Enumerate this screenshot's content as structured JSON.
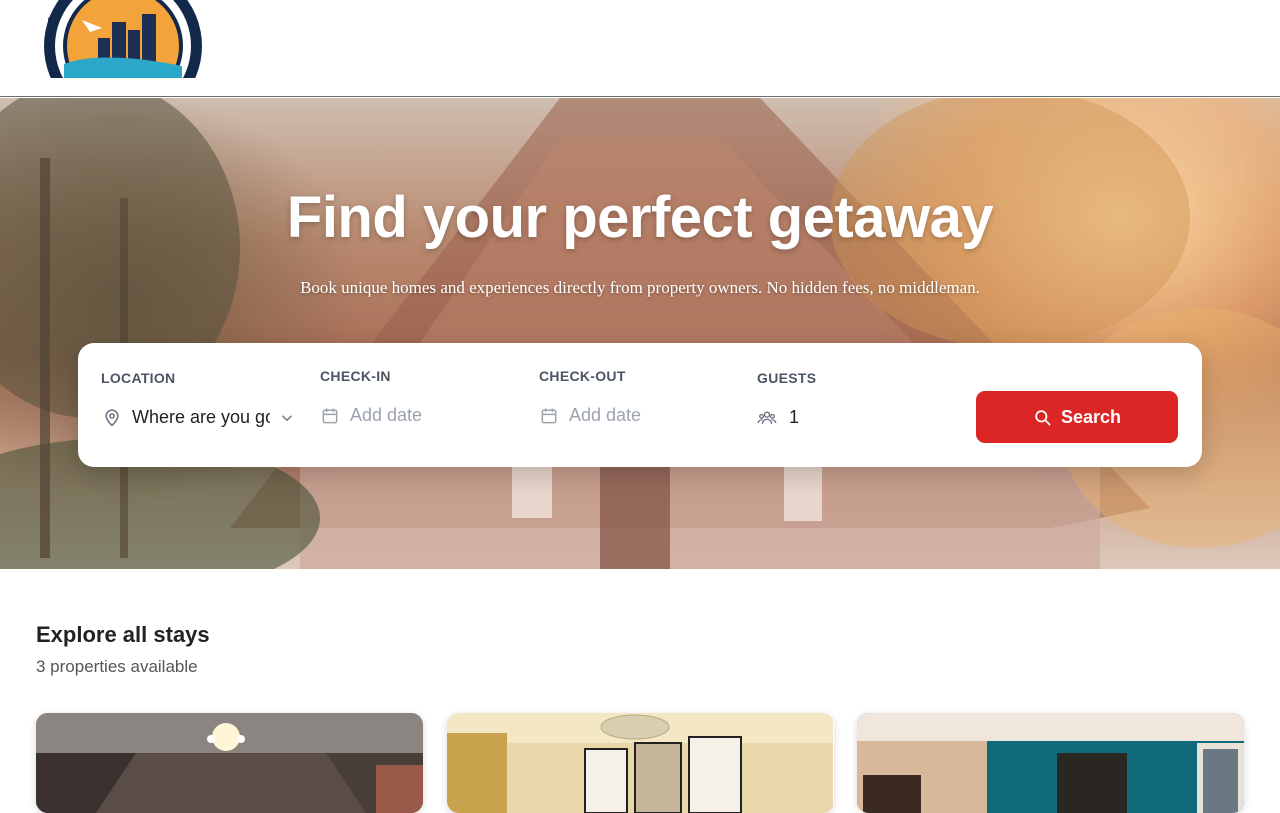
{
  "header": {
    "logo_icon": "city-sunset-badge-logo"
  },
  "hero": {
    "title": "Find your perfect getaway",
    "subtitle": "Book unique homes and experiences directly from property owners. No hidden fees, no middleman."
  },
  "search": {
    "location": {
      "label": "LOCATION",
      "value": "Where are you going?",
      "icon": "map-pin-icon"
    },
    "checkin": {
      "label": "CHECK-IN",
      "placeholder": "Add date",
      "icon": "calendar-icon"
    },
    "checkout": {
      "label": "CHECK-OUT",
      "placeholder": "Add date",
      "icon": "calendar-icon"
    },
    "guests": {
      "label": "GUESTS",
      "value": "1",
      "icon": "users-icon"
    },
    "button_label": "Search",
    "button_color": "#dc2626"
  },
  "listings": {
    "title": "Explore all stays",
    "count_text": "3 properties available",
    "cards": [
      {
        "name": "property-card-1"
      },
      {
        "name": "property-card-2"
      },
      {
        "name": "property-card-3"
      }
    ]
  }
}
